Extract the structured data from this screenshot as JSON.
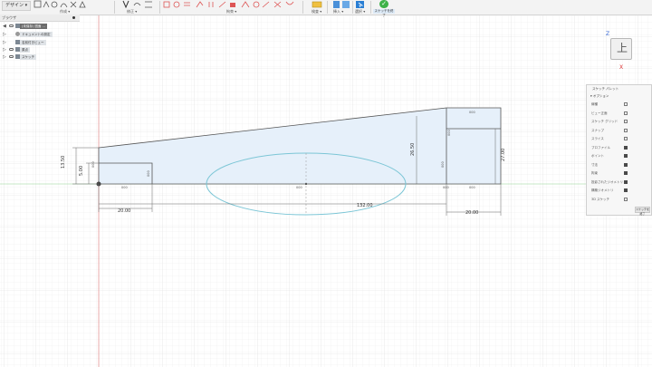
{
  "toolbar": {
    "workspace_label": "デザイン ▾",
    "groups": [
      "作成 ▾",
      "修正 ▾",
      "拘束 ▾",
      "検査 ▾",
      "挿入 ▾",
      "選択 ▾"
    ],
    "finish_label": "スケッチを終了",
    "finish_check": "✓"
  },
  "browser": {
    "title": "ブラウザ",
    "items": [
      {
        "label": "(未保存) 図面 ..."
      },
      {
        "label": "ドキュメントの設定"
      },
      {
        "label": "名前付きビュー"
      },
      {
        "label": "原点"
      },
      {
        "label": "スケッチ"
      }
    ]
  },
  "viewcube": {
    "face_label": "上",
    "axis_z": "Z",
    "axis_x": "X"
  },
  "sketch": {
    "dims": {
      "height_total": "13.50",
      "height_step": "5.00",
      "height_right": "26.50",
      "height_box": "27.00",
      "width_left": "20.00",
      "width_total": "132.00",
      "width_right": "20.00",
      "small_labels": "000"
    }
  },
  "palette": {
    "title": "スケッチ パレット",
    "section": "▾ オプション",
    "rows": [
      {
        "label": "線種",
        "checked": false
      },
      {
        "label": "ビュー正面",
        "checked": false
      },
      {
        "label": "スケッチ グリッド",
        "checked": false
      },
      {
        "label": "スナップ",
        "checked": false
      },
      {
        "label": "スライス",
        "checked": false
      },
      {
        "label": "プロファイル",
        "checked": true
      },
      {
        "label": "ポイント",
        "checked": true
      },
      {
        "label": "寸法",
        "checked": true
      },
      {
        "label": "拘束",
        "checked": true
      },
      {
        "label": "投影されたジオメトリ",
        "checked": true
      },
      {
        "label": "構築ジオメトリ",
        "checked": true
      },
      {
        "label": "3D スケッチ",
        "checked": false
      }
    ],
    "finish_label": "スケッチを終了"
  },
  "colors": {
    "profile_fill": "#e6f0fa",
    "sketch_line": "#555555",
    "ellipse": "#7cc6d6",
    "axis_red": "#e07a7a",
    "axis_green": "#8fd18f"
  }
}
